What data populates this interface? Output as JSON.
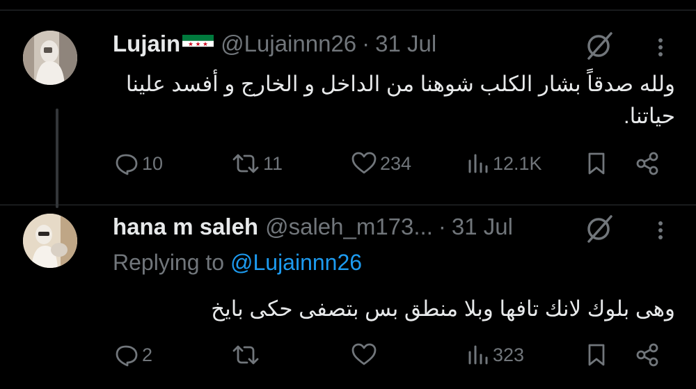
{
  "tweets": [
    {
      "name": "Lujain",
      "handle": "@Lujainnn26",
      "separator": "·",
      "time": "31 Jul",
      "text": "ولله صدقاً بشار الكلب شوهنا من الداخل و الخارج و أفسد علينا حياتنا.",
      "replies": "10",
      "reposts": "11",
      "likes": "234",
      "views": "12.1K"
    },
    {
      "name": "hana m saleh",
      "handle": "@saleh_m173...",
      "separator": "·",
      "time": "31 Jul",
      "replying_prefix": "Replying to",
      "replying_to": "@Lujainnn26",
      "text": "وهى بلوك لانك تافها وبلا منطق بس بتصفى حكى بايخ",
      "replies": "2",
      "reposts": "",
      "likes": "",
      "views": "323"
    }
  ],
  "colors": {
    "background": "#000000",
    "text": "#e7e9ea",
    "muted": "#71767b",
    "link": "#1d9bf0",
    "divider": "#2f3336"
  },
  "icons": [
    "syrian-flag-icon",
    "grok-icon",
    "more-icon",
    "reply-icon",
    "repost-icon",
    "like-icon",
    "views-icon",
    "bookmark-icon",
    "share-icon"
  ]
}
